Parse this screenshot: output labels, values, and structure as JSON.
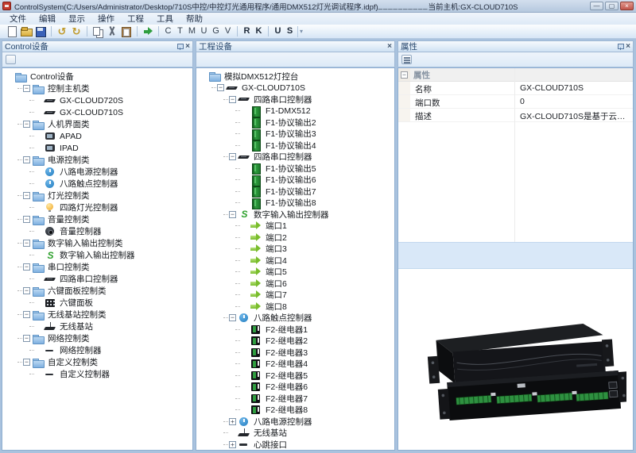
{
  "window": {
    "title": "ControlSystem(C:/Users/Administrator/Desktop/710S中控/中控灯光通用程序/通用DMX512灯光调试程序.idpf)",
    "title_sep": "__________",
    "current_host": "当前主机:GX-CLOUD710S",
    "caption_buttons": {
      "minimize": "—",
      "maximize": "▢",
      "close": "×"
    }
  },
  "menu": [
    "文件",
    "编辑",
    "显示",
    "操作",
    "工程",
    "工具",
    "帮助"
  ],
  "toolbar": {
    "icon_buttons": [
      "new-document",
      "open",
      "save",
      "undo",
      "redo",
      "copy",
      "cut",
      "paste",
      "run"
    ],
    "undo_glyph": "↺",
    "redo_glyph": "↻",
    "letter_groups": [
      {
        "bold": false,
        "letters": [
          "C",
          "T",
          "M",
          "U",
          "G",
          "V"
        ]
      },
      {
        "bold": true,
        "letters": [
          "R",
          "K"
        ]
      },
      {
        "bold": true,
        "letters": [
          "U",
          "S"
        ]
      }
    ]
  },
  "panels": {
    "left": {
      "title": "Control设备",
      "header_icons": [
        "pin-icon",
        "close-icon"
      ],
      "tree": [
        {
          "d": 0,
          "icon": "folder",
          "exp": null,
          "label": "Control设备"
        },
        {
          "d": 1,
          "icon": "folder",
          "exp": "-",
          "label": "控制主机类"
        },
        {
          "d": 2,
          "icon": "device",
          "exp": null,
          "label": "GX-CLOUD720S"
        },
        {
          "d": 2,
          "icon": "device",
          "exp": null,
          "label": "GX-CLOUD710S"
        },
        {
          "d": 1,
          "icon": "folder",
          "exp": "-",
          "label": "人机界面类"
        },
        {
          "d": 2,
          "icon": "tablet",
          "exp": null,
          "label": "APAD"
        },
        {
          "d": 2,
          "icon": "tablet",
          "exp": null,
          "label": "IPAD"
        },
        {
          "d": 1,
          "icon": "folder",
          "exp": "-",
          "label": "电源控制类"
        },
        {
          "d": 2,
          "icon": "power",
          "exp": null,
          "label": "八路电源控制器"
        },
        {
          "d": 2,
          "icon": "power",
          "exp": null,
          "label": "八路触点控制器"
        },
        {
          "d": 1,
          "icon": "folder",
          "exp": "-",
          "label": "灯光控制类"
        },
        {
          "d": 2,
          "icon": "bulb",
          "exp": null,
          "label": "四路灯光控制器"
        },
        {
          "d": 1,
          "icon": "folder",
          "exp": "-",
          "label": "音量控制类"
        },
        {
          "d": 2,
          "icon": "speaker",
          "exp": null,
          "label": "音量控制器"
        },
        {
          "d": 1,
          "icon": "folder",
          "exp": "-",
          "label": "数字输入输出控制类"
        },
        {
          "d": 2,
          "icon": "sgreen",
          "exp": null,
          "label": "数字输入输出控制器"
        },
        {
          "d": 1,
          "icon": "folder",
          "exp": "-",
          "label": "串口控制类"
        },
        {
          "d": 2,
          "icon": "device",
          "exp": null,
          "label": "四路串口控制器"
        },
        {
          "d": 1,
          "icon": "folder",
          "exp": "-",
          "label": "六键面板控制类"
        },
        {
          "d": 2,
          "icon": "keypad",
          "exp": null,
          "label": "六键面板"
        },
        {
          "d": 1,
          "icon": "folder",
          "exp": "-",
          "label": "无线基站控制类"
        },
        {
          "d": 2,
          "icon": "antenna",
          "exp": null,
          "label": "无线基站"
        },
        {
          "d": 1,
          "icon": "folder",
          "exp": "-",
          "label": "网络控制类"
        },
        {
          "d": 2,
          "icon": "dash",
          "exp": null,
          "label": "网络控制器"
        },
        {
          "d": 1,
          "icon": "folder",
          "exp": "-",
          "label": "自定义控制类"
        },
        {
          "d": 2,
          "icon": "dash",
          "exp": null,
          "label": "自定义控制器"
        }
      ]
    },
    "middle": {
      "title": "工程设备",
      "header_icons": [
        "close-icon"
      ],
      "tree": [
        {
          "d": 0,
          "icon": "folder",
          "exp": null,
          "label": "模拟DMX512灯控台"
        },
        {
          "d": 1,
          "icon": "device",
          "exp": "-",
          "label": "GX-CLOUD710S"
        },
        {
          "d": 2,
          "icon": "device",
          "exp": "-",
          "label": "四路串口控制器"
        },
        {
          "d": 3,
          "icon": "module",
          "exp": null,
          "label": "F1-DMX512"
        },
        {
          "d": 3,
          "icon": "module",
          "exp": null,
          "label": "F1-协议输出2"
        },
        {
          "d": 3,
          "icon": "module",
          "exp": null,
          "label": "F1-协议输出3"
        },
        {
          "d": 3,
          "icon": "module",
          "exp": null,
          "label": "F1-协议输出4"
        },
        {
          "d": 2,
          "icon": "device",
          "exp": "-",
          "label": "四路串口控制器"
        },
        {
          "d": 3,
          "icon": "module",
          "exp": null,
          "label": "F1-协议输出5"
        },
        {
          "d": 3,
          "icon": "module",
          "exp": null,
          "label": "F1-协议输出6"
        },
        {
          "d": 3,
          "icon": "module",
          "exp": null,
          "label": "F1-协议输出7"
        },
        {
          "d": 3,
          "icon": "module",
          "exp": null,
          "label": "F1-协议输出8"
        },
        {
          "d": 2,
          "icon": "sgreen",
          "exp": "-",
          "label": "数字输入输出控制器"
        },
        {
          "d": 3,
          "icon": "arrow",
          "exp": null,
          "label": "端口1"
        },
        {
          "d": 3,
          "icon": "arrow",
          "exp": null,
          "label": "端口2"
        },
        {
          "d": 3,
          "icon": "arrow",
          "exp": null,
          "label": "端口3"
        },
        {
          "d": 3,
          "icon": "arrow",
          "exp": null,
          "label": "端口4"
        },
        {
          "d": 3,
          "icon": "arrow",
          "exp": null,
          "label": "端口5"
        },
        {
          "d": 3,
          "icon": "arrow",
          "exp": null,
          "label": "端口6"
        },
        {
          "d": 3,
          "icon": "arrow",
          "exp": null,
          "label": "端口7"
        },
        {
          "d": 3,
          "icon": "arrow",
          "exp": null,
          "label": "端口8"
        },
        {
          "d": 2,
          "icon": "power",
          "exp": "-",
          "label": "八路触点控制器"
        },
        {
          "d": 3,
          "icon": "relay",
          "exp": null,
          "label": "F2-继电器1"
        },
        {
          "d": 3,
          "icon": "relay",
          "exp": null,
          "label": "F2-继电器2"
        },
        {
          "d": 3,
          "icon": "relay",
          "exp": null,
          "label": "F2-继电器3"
        },
        {
          "d": 3,
          "icon": "relay",
          "exp": null,
          "label": "F2-继电器4"
        },
        {
          "d": 3,
          "icon": "relay",
          "exp": null,
          "label": "F2-继电器5"
        },
        {
          "d": 3,
          "icon": "relay",
          "exp": null,
          "label": "F2-继电器6"
        },
        {
          "d": 3,
          "icon": "relay",
          "exp": null,
          "label": "F2-继电器7"
        },
        {
          "d": 3,
          "icon": "relay",
          "exp": null,
          "label": "F2-继电器8"
        },
        {
          "d": 2,
          "icon": "power",
          "exp": "+",
          "label": "八路电源控制器"
        },
        {
          "d": 2,
          "icon": "antenna",
          "exp": null,
          "label": "无线基站"
        },
        {
          "d": 2,
          "icon": "dash",
          "exp": "+",
          "label": "心跳接口"
        }
      ]
    },
    "right": {
      "title": "属性",
      "header_icons": [
        "pin-icon",
        "close-icon"
      ],
      "group_label": "属性",
      "rows": [
        {
          "label": "名称",
          "value": "GX-CLOUD710S"
        },
        {
          "label": "端口数",
          "value": "0"
        },
        {
          "label": "描述",
          "value": "GX-CLOUD710S是基于云端网络通讯..."
        }
      ],
      "photo": "GX-CLOUD710S 2U rack controller product photo"
    }
  }
}
